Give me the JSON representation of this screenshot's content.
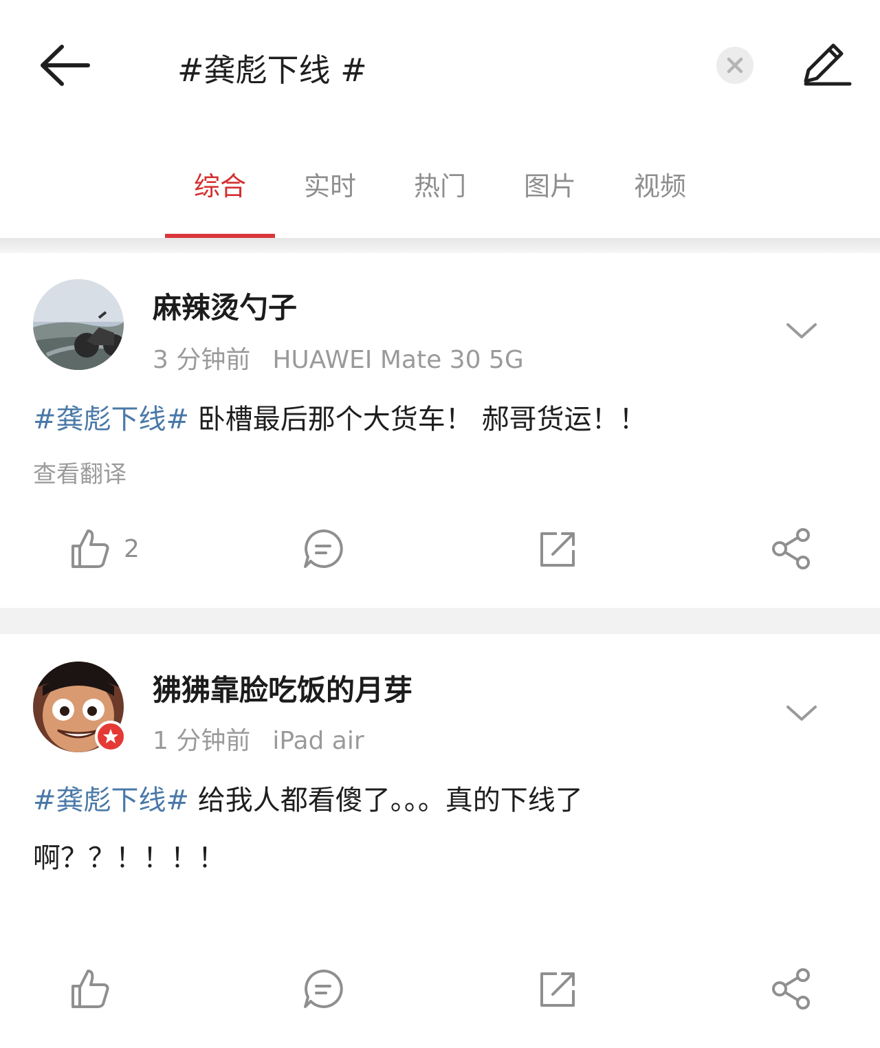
{
  "search": {
    "query": "#龚彪下线 #"
  },
  "tabs": [
    {
      "label": "综合",
      "active": true
    },
    {
      "label": "实时",
      "active": false
    },
    {
      "label": "热门",
      "active": false
    },
    {
      "label": "图片",
      "active": false
    },
    {
      "label": "视频",
      "active": false
    }
  ],
  "colors": {
    "accent": "#d9373b",
    "hashtag": "#4a79a8",
    "meta": "#9a9a9a"
  },
  "posts": [
    {
      "username": "麻辣烫勺子",
      "time": "3 分钟前",
      "device": "HUAWEI Mate 30 5G",
      "hashtag": "#龚彪下线#",
      "body": " 卧槽最后那个大货车！ 郝哥货运！！",
      "translate_label": "查看翻译",
      "likes": "2"
    },
    {
      "username": "狒狒靠脸吃饭的月芽",
      "time": "1 分钟前",
      "device": "iPad air",
      "hashtag": "#龚彪下线#",
      "body": " 给我人都看傻了。。。真的下线了啊？？！！！！"
    }
  ]
}
